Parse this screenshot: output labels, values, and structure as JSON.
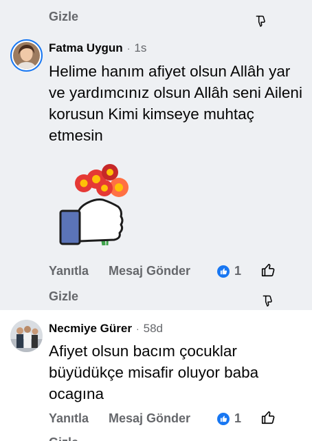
{
  "hide_label": "Gizle",
  "comments": [
    {
      "author": "Fatma Uygun",
      "time": "1s",
      "text": "Helime hanım afiyet olsun Allâh yar ve yardımcınız olsun Allâh seni Aileni korusun Kimi kimseye muhtaç etmesin",
      "reply_label": "Yanıtla",
      "message_label": "Mesaj Gönder",
      "like_count": "1",
      "sticker": "thumbs-up-with-flowers"
    },
    {
      "author": "Necmiye Gürer",
      "time": "58d",
      "text": "Afiyet olsun bacım çocuklar büyüdükçe misafir oluyor baba ocagına",
      "reply_label": "Yanıtla",
      "message_label": "Mesaj Gönder",
      "like_count": "1"
    }
  ],
  "colors": {
    "highlight_bg": "#eef0f3",
    "like_blue": "#1877f2",
    "secondary_text": "#65676b"
  }
}
